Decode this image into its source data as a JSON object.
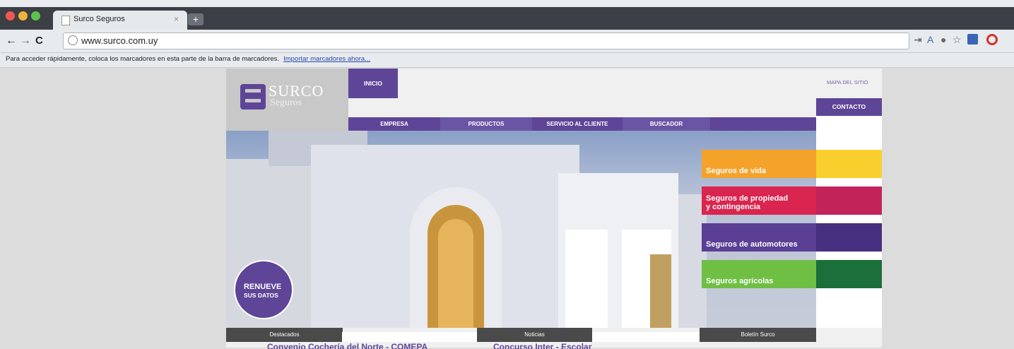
{
  "browser": {
    "tab_title": "Surco Seguros",
    "tab_close": "×",
    "new_tab": "+",
    "back": "←",
    "forward": "→",
    "reload": "C",
    "url": "www.surco.com.uy",
    "bookmark_prompt": "Para acceder rápidamente, coloca los marcadores en esta parte de la barra de marcadores.",
    "bookmark_link": "Importar marcadores ahora..."
  },
  "site": {
    "logo_name": "SURCO",
    "logo_sub": "Seguros",
    "nav_home": "INICIO",
    "sitemap": "MAPA DEL SITIO",
    "contact": "CONTACTO",
    "menu": [
      "EMPRESA",
      "PRODUCTOS",
      "SERVICIO AL CLIENTE",
      "BUSCADOR"
    ],
    "renueve_line1": "RENUEVE",
    "renueve_line2": "SUS DATOS",
    "categories": [
      {
        "label": "Seguros de vida",
        "color": "#f5a22a",
        "ext": "#f8cf2c"
      },
      {
        "label": "Seguros de propiedad\ny contingencia",
        "color": "#d9254f",
        "ext": "#c2245a"
      },
      {
        "label": "Seguros de automotores",
        "color": "#5a3f95",
        "ext": "#47307f"
      },
      {
        "label": "Seguros agrícolas",
        "color": "#6fbf44",
        "ext": "#1a6f3a"
      }
    ],
    "bottom_tabs": [
      "Destacados",
      "Noticias",
      "Boletín Surco"
    ],
    "news": [
      "Convenio Cochería del Norte - COMEPA",
      "Concurso Inter - Escolar"
    ]
  },
  "colors": {
    "brand_purple": "#5e4597",
    "chrome_dark": "#3c3f45"
  }
}
